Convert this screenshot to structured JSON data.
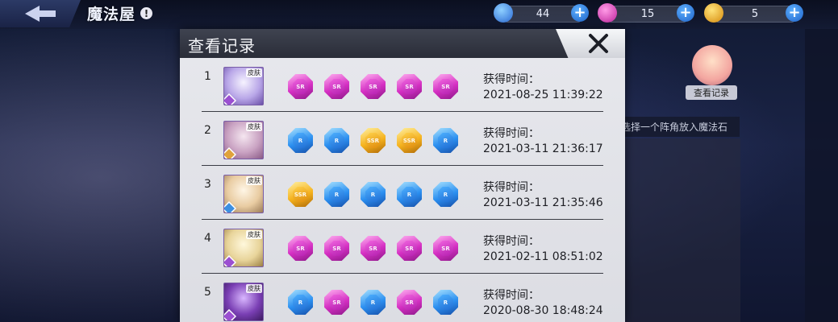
{
  "topbar": {
    "title": "魔法屋",
    "help_icon": "!",
    "resources": [
      {
        "name": "blue-crystal",
        "value": "44",
        "color": "#3b7fd9"
      },
      {
        "name": "pink-crystal",
        "value": "15",
        "color": "#d93bb8"
      },
      {
        "name": "gold-coin",
        "value": "5",
        "color": "#f2a81d"
      }
    ],
    "plus_icon": "+"
  },
  "side": {
    "record_label": "查看记录",
    "hint": "请选择一个阵角放入魔法石"
  },
  "dialog": {
    "title": "查看记录",
    "close_icon": "close-x",
    "rows": [
      {
        "index": "1",
        "tag": "皮肤",
        "gems": [
          "purple",
          "purple",
          "purple",
          "purple",
          "purple"
        ],
        "gem_labels": [
          "SR",
          "SR",
          "SR",
          "SR",
          "SR"
        ],
        "time_label": "获得时间：",
        "time": "2021-08-25 11:39:22"
      },
      {
        "index": "2",
        "tag": "皮肤",
        "gems": [
          "blue",
          "blue",
          "gold",
          "gold",
          "blue"
        ],
        "gem_labels": [
          "R",
          "R",
          "SSR",
          "SSR",
          "R"
        ],
        "time_label": "获得时间：",
        "time": "2021-03-11 21:36:17"
      },
      {
        "index": "3",
        "tag": "皮肤",
        "gems": [
          "gold",
          "blue",
          "blue",
          "blue",
          "blue"
        ],
        "gem_labels": [
          "SSR",
          "R",
          "R",
          "R",
          "R"
        ],
        "time_label": "获得时间：",
        "time": "2021-03-11 21:35:46"
      },
      {
        "index": "4",
        "tag": "皮肤",
        "gems": [
          "purple",
          "purple",
          "purple",
          "purple",
          "purple"
        ],
        "gem_labels": [
          "SR",
          "SR",
          "SR",
          "SR",
          "SR"
        ],
        "time_label": "获得时间：",
        "time": "2021-02-11 08:51:02"
      },
      {
        "index": "5",
        "tag": "皮肤",
        "gems": [
          "blue",
          "purple",
          "blue",
          "purple",
          "blue"
        ],
        "gem_labels": [
          "R",
          "SR",
          "R",
          "SR",
          "R"
        ],
        "time_label": "获得时间：",
        "time": "2020-08-30 18:48:24"
      }
    ]
  }
}
